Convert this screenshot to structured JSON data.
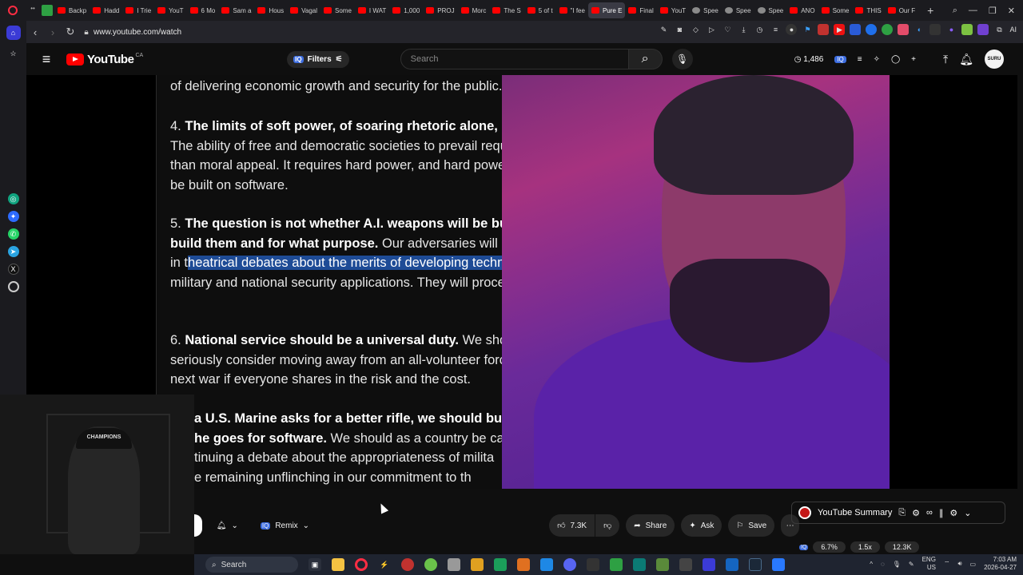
{
  "browser": {
    "tabs": [
      {
        "label": "Backp"
      },
      {
        "label": "Hadd"
      },
      {
        "label": "I Trie"
      },
      {
        "label": "YouT"
      },
      {
        "label": "6 Mo"
      },
      {
        "label": "Sam a"
      },
      {
        "label": "Hous"
      },
      {
        "label": "Vagal"
      },
      {
        "label": "Some"
      },
      {
        "label": "I WAT"
      },
      {
        "label": "1,000"
      },
      {
        "label": "PROJ"
      },
      {
        "label": "Morc"
      },
      {
        "label": "The S"
      },
      {
        "label": "5 of t"
      },
      {
        "label": "\"I fee"
      },
      {
        "label": "Pure E",
        "active": true
      },
      {
        "label": "Final"
      },
      {
        "label": "YouT"
      },
      {
        "label": "Spee"
      },
      {
        "label": "Spee"
      },
      {
        "label": "Spee"
      },
      {
        "label": "ANO"
      },
      {
        "label": "Some"
      },
      {
        "label": "THIS"
      },
      {
        "label": "Our F"
      }
    ],
    "url": "www.youtube.com/watch",
    "ai_label": "AI"
  },
  "youtube": {
    "logo_text": "YouTube",
    "country_code": "CA",
    "filters_label": "Filters",
    "search_placeholder": "Search",
    "views_count": "1,486",
    "avatar_text": "SURU"
  },
  "document": {
    "line_top": "of delivering economic growth and security for the public.",
    "p4_num": "4.",
    "p4_bold": "The limits of soft power, of soaring rhetoric alone, have been exposed.",
    "p4_text": "The ability of free and democratic societies to prevail requires something more than moral appeal. It requires hard power, and hard power in this century will be built on software.",
    "p5_num": "5.",
    "p5_bold": "The question is not whether A.I. weapons will be built; it is who will build them and for what purpose.",
    "p5_text_a": "Our adversaries will not pause to indulge in t",
    "p5_highlight": "heatrical debates about the merits of developing technologies with crit",
    "p5_text_b": "ical military and national security applications. They will proceed.",
    "p6_num": "6.",
    "p6_bold": "National service should be a universal duty.",
    "p6_text": "We should, as a society, seriously consider moving away from an all-volunteer force and only fight the next war if everyone shares in the risk and the cost.",
    "p7_bold_a": "a U.S. Marine asks for a better rifle, we should build",
    "p7_bold_b": "he goes for software.",
    "p7_text_a": "We should as a country be cap",
    "p7_text_b": "tinuing a debate about the appropriateness of milita",
    "p7_text_c": "e remaining unflinching in our commitment to th"
  },
  "webcam": {
    "cap_text": "CHAMPIONS"
  },
  "actions": {
    "remix_label": "Remix",
    "like_count": "7.3K",
    "share_label": "Share",
    "ask_label": "Ask",
    "save_label": "Save"
  },
  "summary": {
    "title": "YouTube Summary",
    "stat1": "6.7%",
    "stat2": "1.5x",
    "stat3": "12.3K"
  },
  "taskbar": {
    "search_label": "Search",
    "lang_top": "ENG",
    "lang_bottom": "US",
    "time": "7:03 AM",
    "date": "2026-04-27"
  }
}
